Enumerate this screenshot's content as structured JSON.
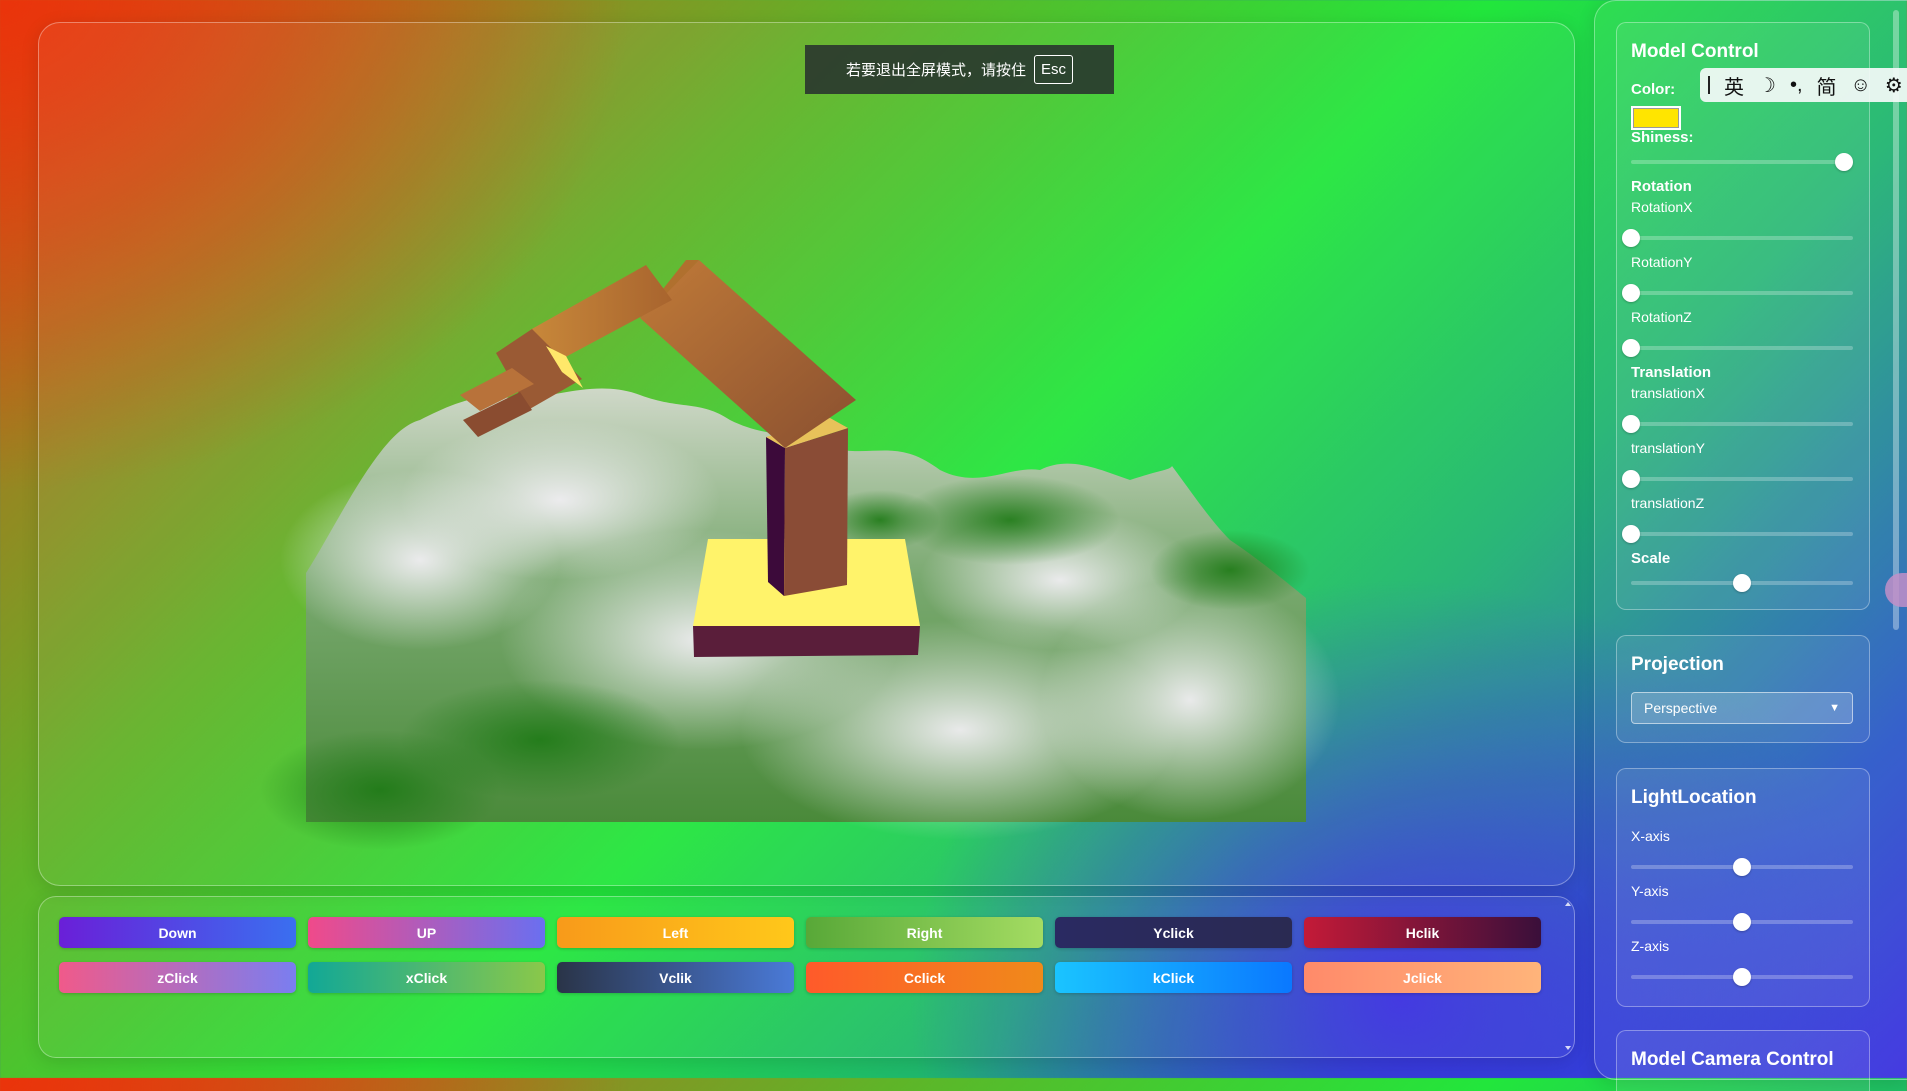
{
  "fullscreen_notice": {
    "text": "若要退出全屏模式，请按住",
    "key": "Esc"
  },
  "buttons": [
    {
      "label": "Down",
      "bg": "linear-gradient(90deg,#6a1fd8,#3a6ff0)"
    },
    {
      "label": "UP",
      "bg": "linear-gradient(90deg,#f04a8a,#6a6ff0)"
    },
    {
      "label": "Left",
      "bg": "linear-gradient(90deg,#f89a1a,#ffc81a)"
    },
    {
      "label": "Right",
      "bg": "linear-gradient(90deg,#58a838,#a4dc62)"
    },
    {
      "label": "Yclick",
      "bg": "linear-gradient(90deg,#2a2a62,#2a2a52)"
    },
    {
      "label": "Hclik",
      "bg": "linear-gradient(90deg,#c41a38,#3a0f3a)"
    },
    {
      "label": "zClick",
      "bg": "linear-gradient(90deg,#f05a8a,#7a7ef0)"
    },
    {
      "label": "xClick",
      "bg": "linear-gradient(90deg,#12a896,#8ac84a)"
    },
    {
      "label": "Vclik",
      "bg": "linear-gradient(90deg,#2a3448,#4a7ad8)"
    },
    {
      "label": "Cclick",
      "bg": "linear-gradient(90deg,#ff5a2a,#f08a1a)"
    },
    {
      "label": "kClick",
      "bg": "linear-gradient(90deg,#1ac4ff,#0a78ff)"
    },
    {
      "label": "Jclick",
      "bg": "linear-gradient(90deg,#ff8a6a,#ffb47a)"
    }
  ],
  "model_control": {
    "title": "Model Control",
    "color_label": "Color:",
    "color_value": "#ffe500",
    "shiness_label": "Shiness:",
    "shiness_value": 0.96,
    "rotation_label": "Rotation",
    "rotation_x_label": "RotationX",
    "rotation_x_value": 0.0,
    "rotation_y_label": "RotationY",
    "rotation_y_value": 0.0,
    "rotation_z_label": "RotationZ",
    "rotation_z_value": 0.0,
    "translation_label": "Translation",
    "translation_x_label": "translationX",
    "translation_x_value": 0.0,
    "translation_y_label": "translationY",
    "translation_y_value": 0.0,
    "translation_z_label": "translationZ",
    "translation_z_value": 0.0,
    "scale_label": "Scale",
    "scale_value": 0.5
  },
  "projection": {
    "title": "Projection",
    "selected": "Perspective"
  },
  "light_location": {
    "title": "LightLocation",
    "x_label": "X-axis",
    "x_value": 0.5,
    "y_label": "Y-axis",
    "y_value": 0.5,
    "z_label": "Z-axis",
    "z_value": 0.5
  },
  "model_camera": {
    "title": "Model Camera Control"
  },
  "ime": {
    "items": [
      "英",
      "☽",
      "•,",
      "简",
      "☺",
      "⚙"
    ]
  }
}
